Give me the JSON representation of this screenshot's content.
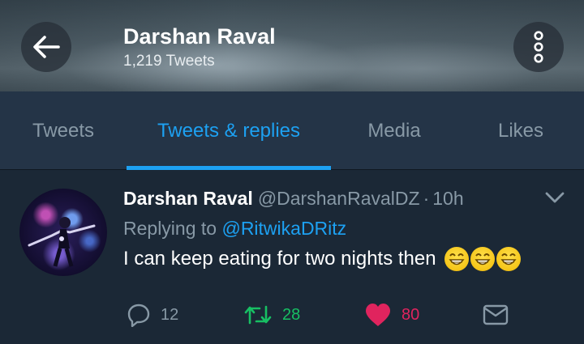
{
  "header": {
    "name": "Darshan Raval",
    "tweet_count": "1,219 Tweets",
    "back_icon": "arrow-left-icon",
    "more_icon": "more-vertical-icon"
  },
  "tabs": [
    {
      "label": "Tweets",
      "active": false
    },
    {
      "label": "Tweets & replies",
      "active": true
    },
    {
      "label": "Media",
      "active": false
    },
    {
      "label": "Likes",
      "active": false
    }
  ],
  "tweet": {
    "author_name": "Darshan Raval",
    "handle": "@DarshanRavalDZ",
    "separator": "·",
    "time": "10h",
    "replying_prefix": "Replying to",
    "replying_to": "@RitwikaDRitz",
    "text": "I can keep eating for two nights then",
    "emoji": [
      "grinning-face-icon",
      "grinning-face-icon",
      "grinning-face-icon"
    ],
    "actions": {
      "reply_count": "12",
      "retweet_count": "28",
      "like_count": "80"
    }
  },
  "colors": {
    "accent": "#1da1f2",
    "retweet": "#17bf63",
    "like": "#e0245e",
    "muted": "#8899a6",
    "background": "#1b2836",
    "tabs_background": "#243447"
  }
}
